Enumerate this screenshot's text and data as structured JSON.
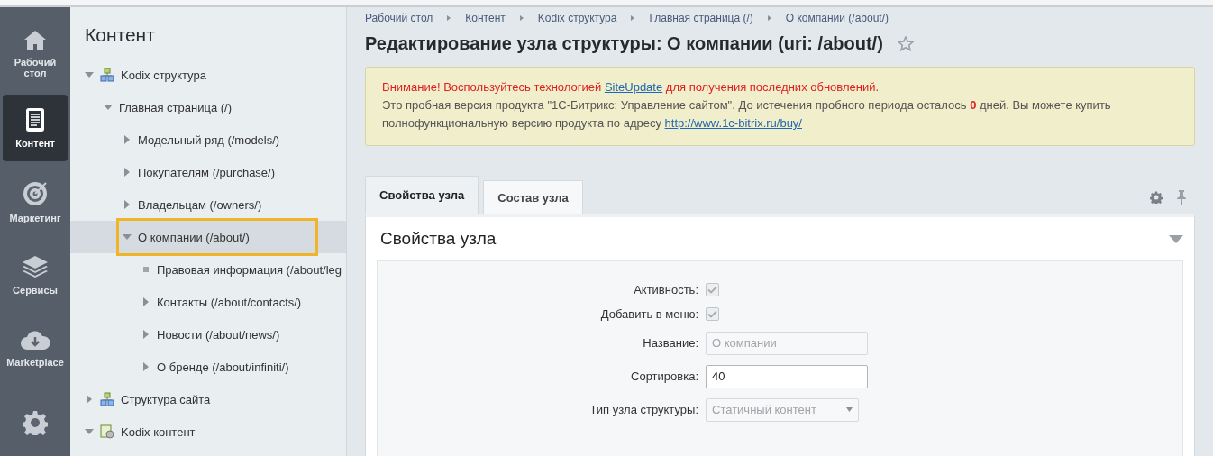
{
  "rail": [
    {
      "label": "Рабочий\nстол",
      "kind": "home",
      "selected": false
    },
    {
      "label": "Контент",
      "kind": "document",
      "selected": true
    },
    {
      "label": "Маркетинг",
      "kind": "target",
      "selected": false
    },
    {
      "label": "Сервисы",
      "kind": "layers",
      "selected": false
    },
    {
      "label": "Marketplace",
      "kind": "cloud",
      "selected": false
    },
    {
      "kind": "gear",
      "selected": false
    }
  ],
  "tree": {
    "title": "Контент",
    "items": [
      {
        "label": "Kodix структура",
        "kind": "structure",
        "expanded": true,
        "selected": false,
        "children": [
          {
            "label": "Главная страница (/)",
            "kind": "folder",
            "expanded": true,
            "selected": false,
            "children": [
              {
                "label": "Модельный ряд (/models/)",
                "kind": "folder",
                "expanded": false,
                "selected": false
              },
              {
                "label": "Покупателям (/purchase/)",
                "kind": "folder",
                "expanded": false,
                "selected": false
              },
              {
                "label": "Владельцам (/owners/)",
                "kind": "folder",
                "expanded": false,
                "selected": false
              },
              {
                "label": "О компании (/about/)",
                "kind": "folder",
                "expanded": true,
                "selected": true,
                "children": [
                  {
                    "label": "Правовая информация (/about/leg",
                    "kind": "leaf",
                    "expanded": false,
                    "selected": false
                  },
                  {
                    "label": "Контакты (/about/contacts/)",
                    "kind": "folder",
                    "expanded": false,
                    "selected": false
                  },
                  {
                    "label": "Новости (/about/news/)",
                    "kind": "folder",
                    "expanded": false,
                    "selected": false
                  },
                  {
                    "label": "О бренде (/about/infiniti/)",
                    "kind": "folder",
                    "expanded": false,
                    "selected": false
                  }
                ]
              }
            ]
          }
        ]
      },
      {
        "label": "Структура сайта",
        "kind": "structure",
        "expanded": false,
        "selected": false
      },
      {
        "label": "Kodix контент",
        "kind": "content",
        "expanded": true,
        "selected": false
      }
    ]
  },
  "breadcrumbs": [
    "Рабочий стол",
    "Контент",
    "Kodix структура",
    "Главная страница (/)",
    "О компании (/about/)"
  ],
  "page_title": "Редактирование узла структуры: О компании (uri: /about/)",
  "favorite": false,
  "alert": {
    "warning_before": "Внимание! Воспользуйтесь технологией ",
    "warning_link": "SiteUpdate",
    "warning_after": " для получения последних обновлений.",
    "message": "Это пробная версия продукта \"1С-Битрикс: Управление сайтом\". До истечения пробного периода осталось **0** дней. Вы можете купить полнофункциональную версию продукта по адресу ",
    "message_link": "http://www.1c-bitrix.ru/buy/"
  },
  "tabs": [
    {
      "label": "Свойства узла",
      "selected": true
    },
    {
      "label": "Состав узла",
      "selected": false
    }
  ],
  "section_title": "Свойства узла",
  "fields": [
    {
      "label": "Активность:",
      "kind": "checkbox",
      "checked": true,
      "disabled": true
    },
    {
      "label": "Добавить в меню:",
      "kind": "checkbox",
      "checked": true,
      "disabled": true
    },
    {
      "label": "Название:",
      "kind": "text",
      "value": "О компании",
      "disabled": true
    },
    {
      "label": "Сортировка:",
      "kind": "text",
      "value": "40",
      "disabled": false
    },
    {
      "label": "Тип узла структуры:",
      "kind": "select",
      "value": "Статичный контент",
      "disabled": true
    }
  ]
}
